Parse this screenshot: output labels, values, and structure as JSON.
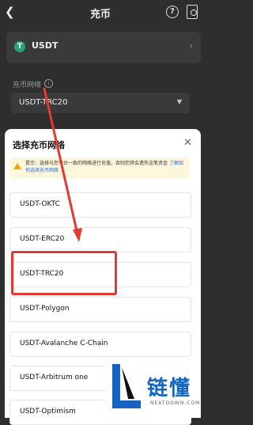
{
  "header": {
    "back_icon": "chevron-left-icon",
    "title": "充币",
    "help_icon": "question-circle-icon",
    "history_icon": "history-icon"
  },
  "coin": {
    "symbol_glyph": "T",
    "name": "USDT",
    "chevron": "›"
  },
  "network_field": {
    "label": "充币网络",
    "info_glyph": "i",
    "value": "USDT-TRC20",
    "caret": "▼"
  },
  "sheet": {
    "title": "选择充币网络",
    "close_glyph": "✕",
    "notice": {
      "text": "提示：选择与您平台一致的网络进行充值，否则您将会遗失这笔资金",
      "link": "了解如何选择充币网络"
    },
    "options": [
      {
        "label": "USDT-OKTC"
      },
      {
        "label": "USDT-ERC20"
      },
      {
        "label": "USDT-TRC20"
      },
      {
        "label": "USDT-Polygon"
      },
      {
        "label": "USDT-Avalanche C-Chain"
      },
      {
        "label": "USDT-Arbitrum one"
      },
      {
        "label": "USDT-Optimism"
      }
    ]
  },
  "annotation": {
    "color": "#e53935"
  },
  "watermark": {
    "name": "链懂",
    "domain": "NEATDOWN.COM"
  }
}
